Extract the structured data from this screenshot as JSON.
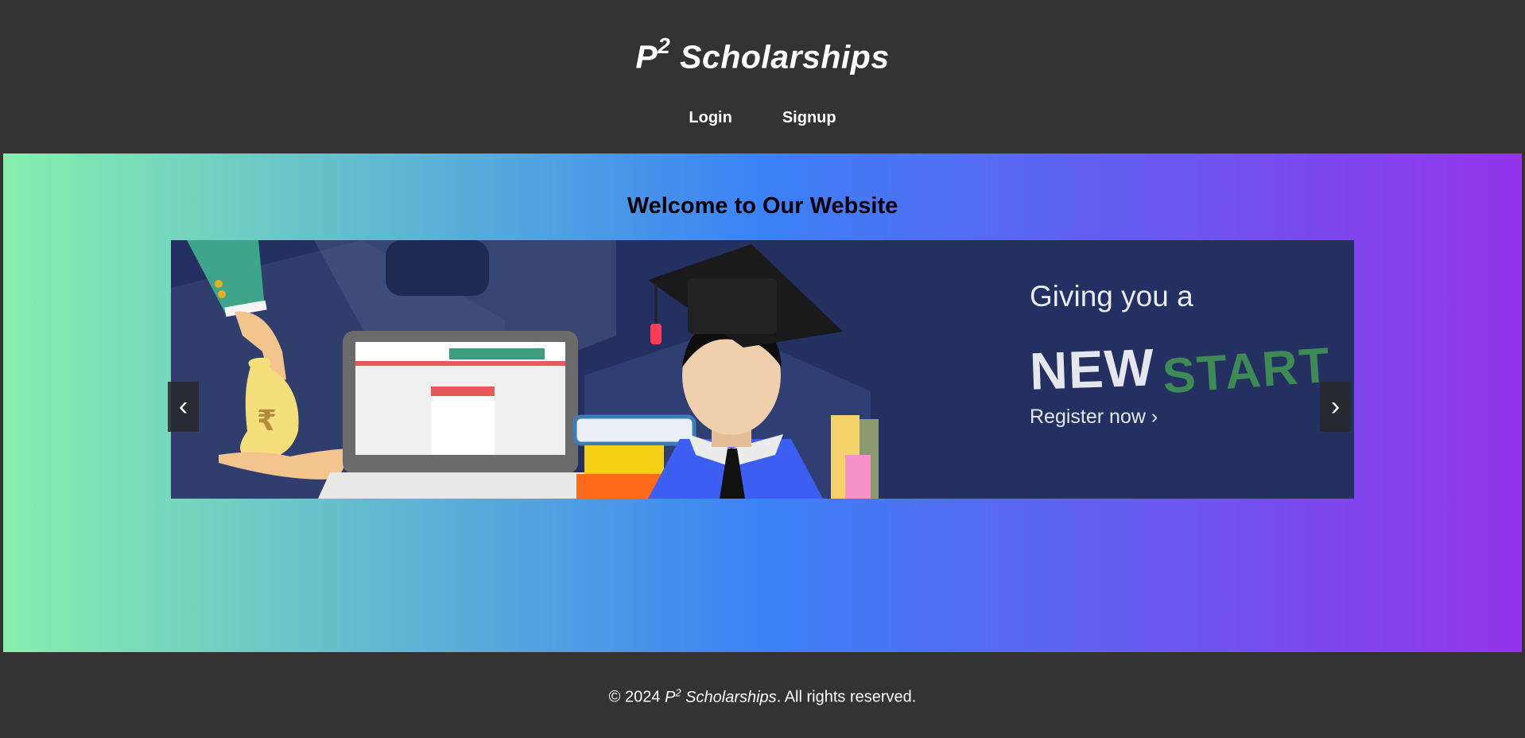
{
  "header": {
    "brand_prefix": "P",
    "brand_sup": "2",
    "brand_name": "Scholarships",
    "nav": [
      {
        "label": "Login"
      },
      {
        "label": "Signup"
      }
    ]
  },
  "main": {
    "welcome": "Welcome to Our Website",
    "carousel": {
      "prev_label": "‹",
      "next_label": "›",
      "slide": {
        "line1": "Giving you a",
        "new_word": "NEW",
        "start_word": "START",
        "register": "Register now ›",
        "currency_symbol": "₹"
      }
    }
  },
  "footer": {
    "copyright_prefix": "© 2024",
    "brand_prefix": "P",
    "brand_sup": "2",
    "brand_name": "Scholarships",
    "copyright_suffix": ". All rights reserved."
  },
  "colors": {
    "background": "#333333",
    "gradient_start": "#86efac",
    "gradient_mid": "#3b82f6",
    "gradient_end": "#9333ea",
    "slide_bg": "#233061"
  }
}
